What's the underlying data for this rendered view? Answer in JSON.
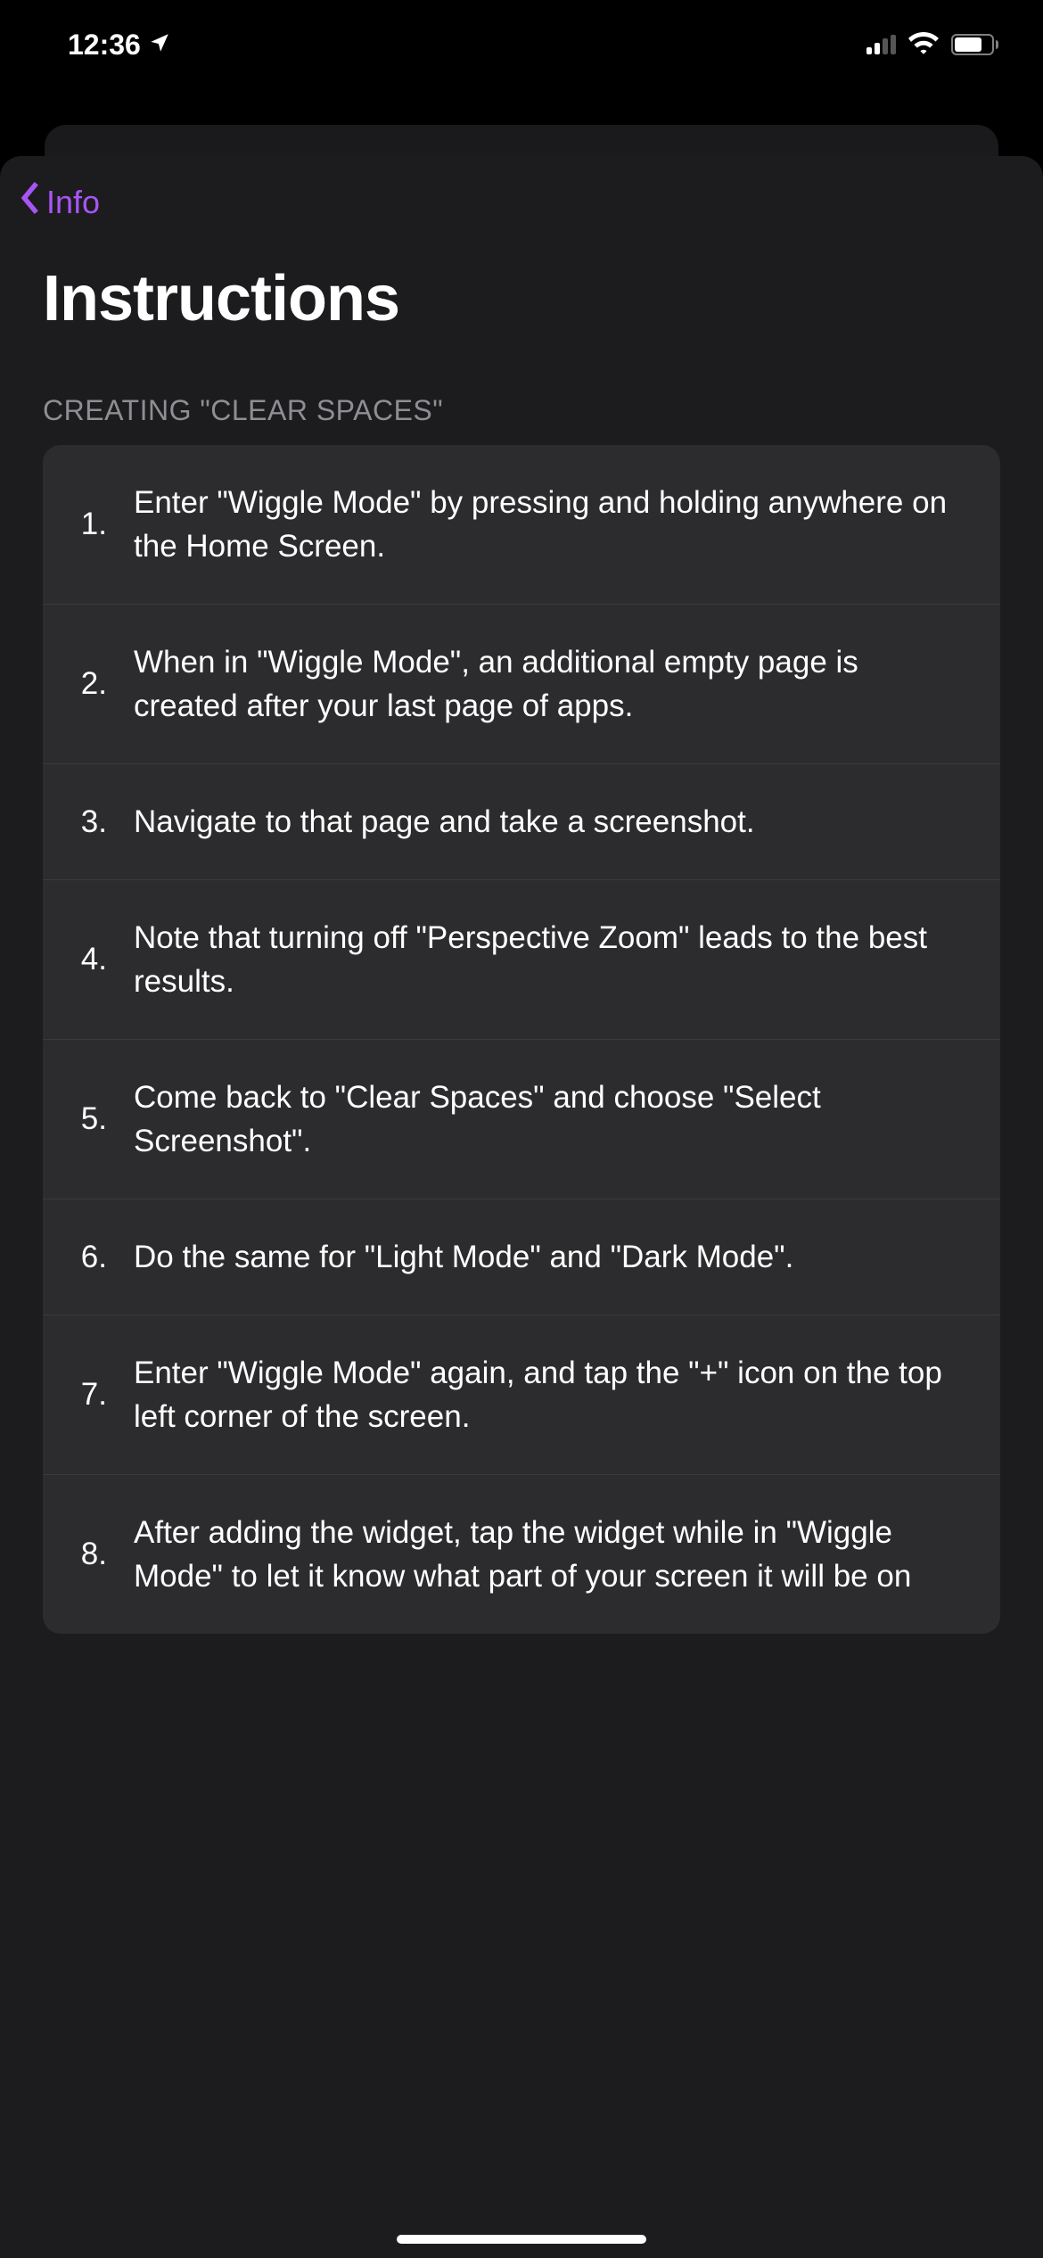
{
  "status_bar": {
    "time": "12:36"
  },
  "nav": {
    "back_label": "Info"
  },
  "header": {
    "title": "Instructions"
  },
  "section": {
    "label": "CREATING \"CLEAR SPACES\""
  },
  "steps": [
    {
      "num": "1.",
      "text": "Enter \"Wiggle Mode\" by pressing and holding anywhere on the Home Screen."
    },
    {
      "num": "2.",
      "text": "When in \"Wiggle Mode\", an additional empty page is created after your last page of apps."
    },
    {
      "num": "3.",
      "text": "Navigate to that page and take a screenshot."
    },
    {
      "num": "4.",
      "text": "Note that turning off \"Perspective Zoom\" leads to the best results."
    },
    {
      "num": "5.",
      "text": "Come back to \"Clear Spaces\" and choose \"Select Screenshot\"."
    },
    {
      "num": "6.",
      "text": "Do the same for \"Light Mode\" and \"Dark Mode\"."
    },
    {
      "num": "7.",
      "text": "Enter \"Wiggle Mode\" again, and tap the \"+\" icon on the top left corner of the screen."
    },
    {
      "num": "8.",
      "text": "After adding the widget, tap the widget while in \"Wiggle Mode\" to let it know what part of your screen it will be on"
    }
  ]
}
